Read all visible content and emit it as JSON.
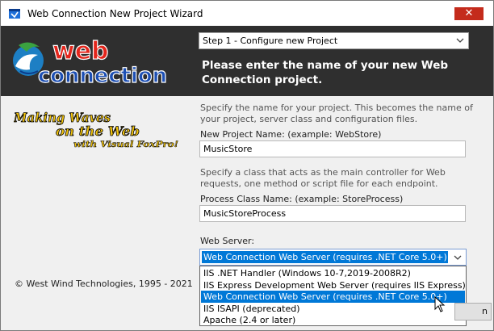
{
  "window": {
    "title": "Web Connection New Project Wizard",
    "close_glyph": "✕",
    "app_icon": "wizard-app-icon"
  },
  "header": {
    "logo": {
      "line1": "web",
      "line2": "connection"
    },
    "step_select": {
      "value": "Step 1 - Configure new Project"
    },
    "heading": "Please enter the name of your new Web Connection project."
  },
  "slogan": {
    "line1": "Making Waves",
    "line2": "on the Web",
    "line3": "with Visual FoxPro!"
  },
  "form": {
    "project_help": "Specify the name for your project. This becomes the name of your project, server class and configuration files.",
    "project_label": "New Project Name:   (example: WebStore)",
    "project_value": "MusicStore",
    "class_help": "Specify a  class that acts as the  main controller for Web requests, one method or script file for each endpoint.",
    "class_label": "Process Class Name:  (example: StoreProcess)",
    "class_value": "MusicStoreProcess",
    "server_label": "Web Server:",
    "server_value": "Web Connection Web Server (requires .NET Core 5.0+)",
    "server_options": [
      "IIS .NET Handler (Windows 10-7,2019-2008R2)",
      "IIS Express Development Web Server (requires IIS Express)",
      "Web Connection Web Server (requires .NET Core 5.0+)",
      "IIS ISAPI (deprecated)",
      "Apache (2.4 or later)"
    ],
    "highlighted_option_index": 2
  },
  "footer": {
    "copyright": "© West Wind Technologies, 1995 - 2021",
    "button_fragment": "n"
  },
  "colors": {
    "header_bg": "#2f2f2f",
    "selection": "#0078d7",
    "logo_red": "#e4261c",
    "logo_blue": "#1d4fb3",
    "slogan_yellow": "#f2c40f"
  }
}
